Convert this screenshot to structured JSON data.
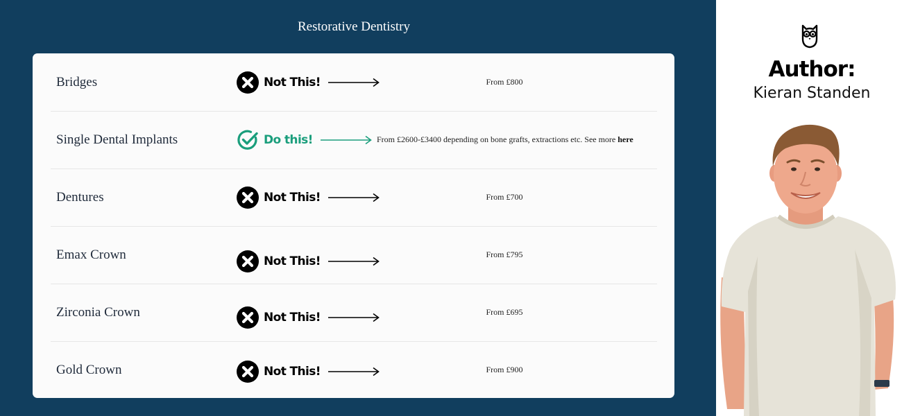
{
  "section": {
    "title": "Restorative Dentistry"
  },
  "rows": [
    {
      "name": "Bridges",
      "verdict": "Not This!",
      "price": "From £800"
    },
    {
      "name": "Single Dental Implants",
      "verdict": "Do this!",
      "price": "From £2600-£3400 depending on bone grafts, extractions etc. See more",
      "link": "here"
    },
    {
      "name": "Dentures",
      "verdict": "Not This!",
      "price": "From £700"
    },
    {
      "name": "Emax Crown",
      "verdict": "Not This!",
      "price": "From £795"
    },
    {
      "name": "Zirconia Crown",
      "verdict": "Not This!",
      "price": "From £695"
    },
    {
      "name": "Gold Crown",
      "verdict": "Not This!",
      "price": "From £900"
    }
  ],
  "icons": {
    "bad": "x-circle-icon",
    "good": "check-circle-icon",
    "arrow": "arrow-right-icon",
    "logo": "owl-icon"
  },
  "colors": {
    "navy": "#113e5e",
    "good": "#1a9e7c",
    "card": "#fbfbfb"
  },
  "author": {
    "heading": "Author:",
    "name": "Kieran Standen"
  }
}
